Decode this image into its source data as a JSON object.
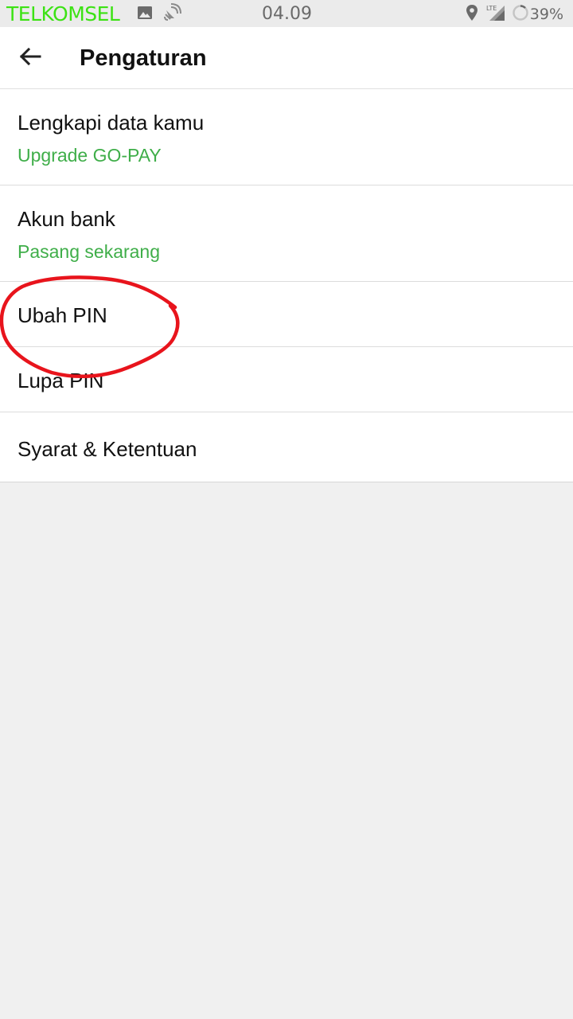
{
  "status_bar": {
    "carrier": "TELKOMSEL",
    "time": "04.09",
    "network_type": "LTE",
    "battery": "39%",
    "carrier_color": "#3ce214",
    "icons": [
      "image-icon",
      "satellite-icon",
      "location-icon",
      "signal-icon",
      "battery-ring-icon"
    ]
  },
  "app_bar": {
    "title": "Pengaturan",
    "back_icon": "arrow-left-icon"
  },
  "settings": {
    "accent_color": "#3fae49",
    "items": [
      {
        "title": "Lengkapi data kamu",
        "subtitle": "Upgrade GO-PAY"
      },
      {
        "title": "Akun bank",
        "subtitle": "Pasang sekarang"
      },
      {
        "title": "Ubah PIN"
      },
      {
        "title": "Lupa PIN"
      },
      {
        "title": "Syarat & Ketentuan"
      }
    ]
  },
  "annotation": {
    "shape": "hand-drawn circle",
    "color": "#e8141c"
  }
}
